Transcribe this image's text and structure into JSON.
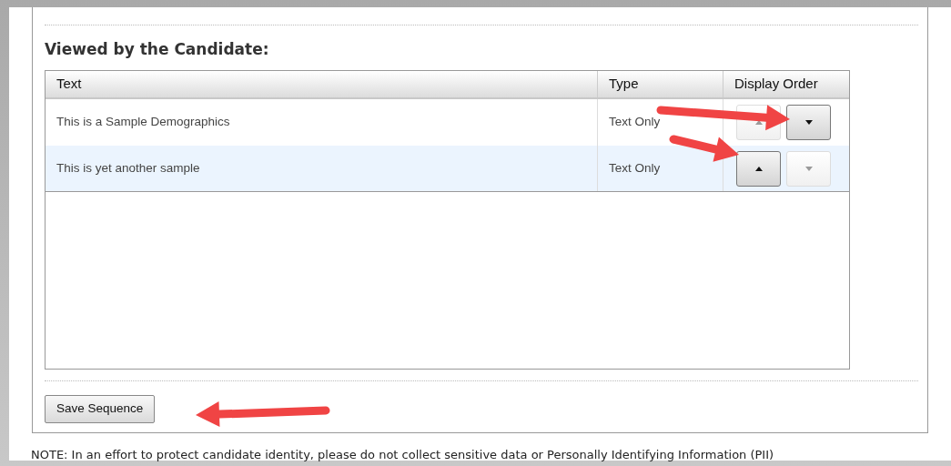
{
  "section": {
    "heading": "Viewed by the Candidate:"
  },
  "table": {
    "columns": [
      "Text",
      "Type",
      "Display Order"
    ],
    "rows": [
      {
        "text": "This is a Sample Demographics",
        "type": "Text Only",
        "selected": false,
        "order_buttons": [
          {
            "kind": "up",
            "disabled": true
          },
          {
            "kind": "down",
            "disabled": false
          }
        ]
      },
      {
        "text": "This is yet another sample",
        "type": "Text Only",
        "selected": true,
        "order_buttons": [
          {
            "kind": "up",
            "disabled": false
          },
          {
            "kind": "down",
            "disabled": true
          }
        ]
      }
    ]
  },
  "save_button": "Save Sequence",
  "note": "NOTE: In an effort to protect candidate identity, please do not collect sensitive data or Personally Identifying Information (PII)"
}
